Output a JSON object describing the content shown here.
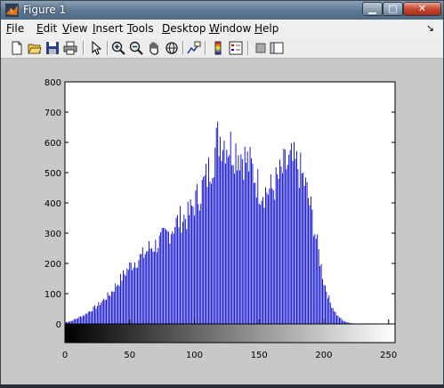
{
  "window": {
    "title": "Figure 1",
    "controls": {
      "minimize": "▁",
      "maximize": "□",
      "close": "✕"
    }
  },
  "menu": {
    "items": [
      {
        "label": "File",
        "accel": "F",
        "rest": "ile"
      },
      {
        "label": "Edit",
        "accel": "E",
        "rest": "dit"
      },
      {
        "label": "View",
        "accel": "V",
        "rest": "iew"
      },
      {
        "label": "Insert",
        "accel": "I",
        "rest": "nsert"
      },
      {
        "label": "Tools",
        "accel": "T",
        "rest": "ools"
      },
      {
        "label": "Desktop",
        "accel": "D",
        "rest": "esktop"
      },
      {
        "label": "Window",
        "accel": "W",
        "rest": "indow"
      },
      {
        "label": "Help",
        "accel": "H",
        "rest": "elp"
      }
    ],
    "dock_arrow": "↘"
  },
  "toolbar": {
    "icons": [
      "new-figure-icon",
      "open-file-icon",
      "save-icon",
      "print-icon",
      "edit-plot-arrow-icon",
      "zoom-in-icon",
      "zoom-out-icon",
      "pan-hand-icon",
      "rotate-3d-icon",
      "data-cursor-icon",
      "insert-colorbar-icon",
      "insert-legend-icon",
      "hide-plot-tools-icon",
      "show-plot-tools-icon"
    ]
  },
  "chart_data": {
    "type": "bar",
    "title": "",
    "xlabel": "",
    "ylabel": "",
    "xlim": [
      0,
      255
    ],
    "ylim": [
      0,
      800
    ],
    "xticks": [
      0,
      50,
      100,
      150,
      200,
      250
    ],
    "yticks": [
      0,
      100,
      200,
      300,
      400,
      500,
      600,
      700,
      800
    ],
    "bar_color": "#0000c8",
    "colorbar": "gray",
    "anchors": [
      [
        0,
        5
      ],
      [
        5,
        10
      ],
      [
        10,
        20
      ],
      [
        15,
        30
      ],
      [
        20,
        45
      ],
      [
        25,
        60
      ],
      [
        30,
        80
      ],
      [
        35,
        100
      ],
      [
        40,
        130
      ],
      [
        45,
        160
      ],
      [
        50,
        190
      ],
      [
        55,
        210
      ],
      [
        60,
        225
      ],
      [
        65,
        250
      ],
      [
        70,
        260
      ],
      [
        75,
        280
      ],
      [
        80,
        300
      ],
      [
        85,
        330
      ],
      [
        90,
        350
      ],
      [
        95,
        355
      ],
      [
        100,
        400
      ],
      [
        105,
        440
      ],
      [
        110,
        490
      ],
      [
        115,
        560
      ],
      [
        118,
        610
      ],
      [
        120,
        620
      ],
      [
        125,
        600
      ],
      [
        130,
        580
      ],
      [
        135,
        570
      ],
      [
        140,
        540
      ],
      [
        145,
        510
      ],
      [
        150,
        450
      ],
      [
        155,
        440
      ],
      [
        160,
        445
      ],
      [
        165,
        480
      ],
      [
        170,
        520
      ],
      [
        175,
        535
      ],
      [
        180,
        520
      ],
      [
        185,
        470
      ],
      [
        190,
        380
      ],
      [
        195,
        260
      ],
      [
        200,
        140
      ],
      [
        205,
        70
      ],
      [
        210,
        30
      ],
      [
        215,
        10
      ],
      [
        220,
        3
      ],
      [
        225,
        1
      ],
      [
        230,
        0
      ]
    ]
  }
}
